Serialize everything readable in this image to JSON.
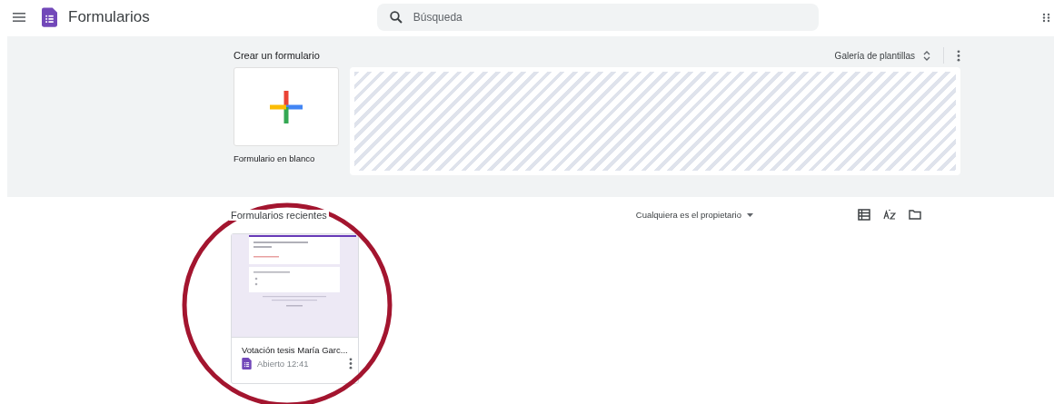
{
  "app_bar": {
    "title": "Formularios",
    "search": {
      "placeholder": "Búsqueda"
    }
  },
  "create": {
    "heading": "Crear un formulario",
    "blank_label": "Formulario en blanco",
    "gallery_button": "Galería de plantillas"
  },
  "recent": {
    "heading": "Formularios recientes",
    "owner_filter": "Cualquiera es el propietario",
    "forms": [
      {
        "title": "Votación tesis María Garc...",
        "status": "Abierto 12:41"
      }
    ]
  },
  "annotation": {
    "kind": "circle",
    "color": "#a3152f"
  }
}
